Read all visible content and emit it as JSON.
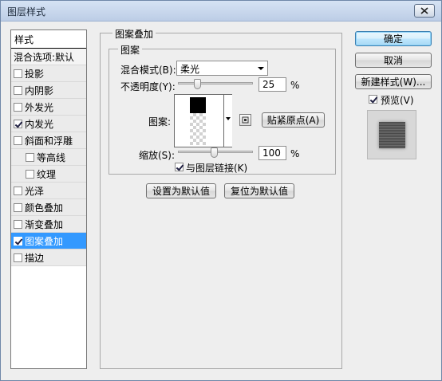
{
  "window": {
    "title": "图层样式"
  },
  "style_list": {
    "header": "样式",
    "blend_options": "混合选项:默认",
    "items": [
      {
        "label": "投影",
        "checked": false
      },
      {
        "label": "内阴影",
        "checked": false
      },
      {
        "label": "外发光",
        "checked": false
      },
      {
        "label": "内发光",
        "checked": true
      },
      {
        "label": "斜面和浮雕",
        "checked": false
      },
      {
        "label": "等高线",
        "checked": false
      },
      {
        "label": "纹理",
        "checked": false
      },
      {
        "label": "光泽",
        "checked": false
      },
      {
        "label": "颜色叠加",
        "checked": false
      },
      {
        "label": "渐变叠加",
        "checked": false
      },
      {
        "label": "图案叠加",
        "checked": true,
        "selected": true
      },
      {
        "label": "描边",
        "checked": false
      }
    ]
  },
  "panel": {
    "group_title": "图案叠加",
    "subgroup_title": "图案",
    "blend_mode_label": "混合模式(B):",
    "blend_mode_value": "柔光",
    "opacity_label": "不透明度(Y):",
    "opacity_value": "25",
    "opacity_unit": "%",
    "opacity_level": 0.25,
    "pattern_label": "图案:",
    "snap_origin_button": "贴紧原点(A)",
    "scale_label": "缩放(S):",
    "scale_value": "100",
    "scale_unit": "%",
    "link_layer_label": "与图层链接(K)",
    "link_layer_checked": true,
    "set_default_button": "设置为默认值",
    "reset_default_button": "复位为默认值"
  },
  "actions": {
    "ok": "确定",
    "cancel": "取消",
    "new_style": "新建样式(W)...",
    "preview_label": "预览(V)",
    "preview_checked": true
  }
}
